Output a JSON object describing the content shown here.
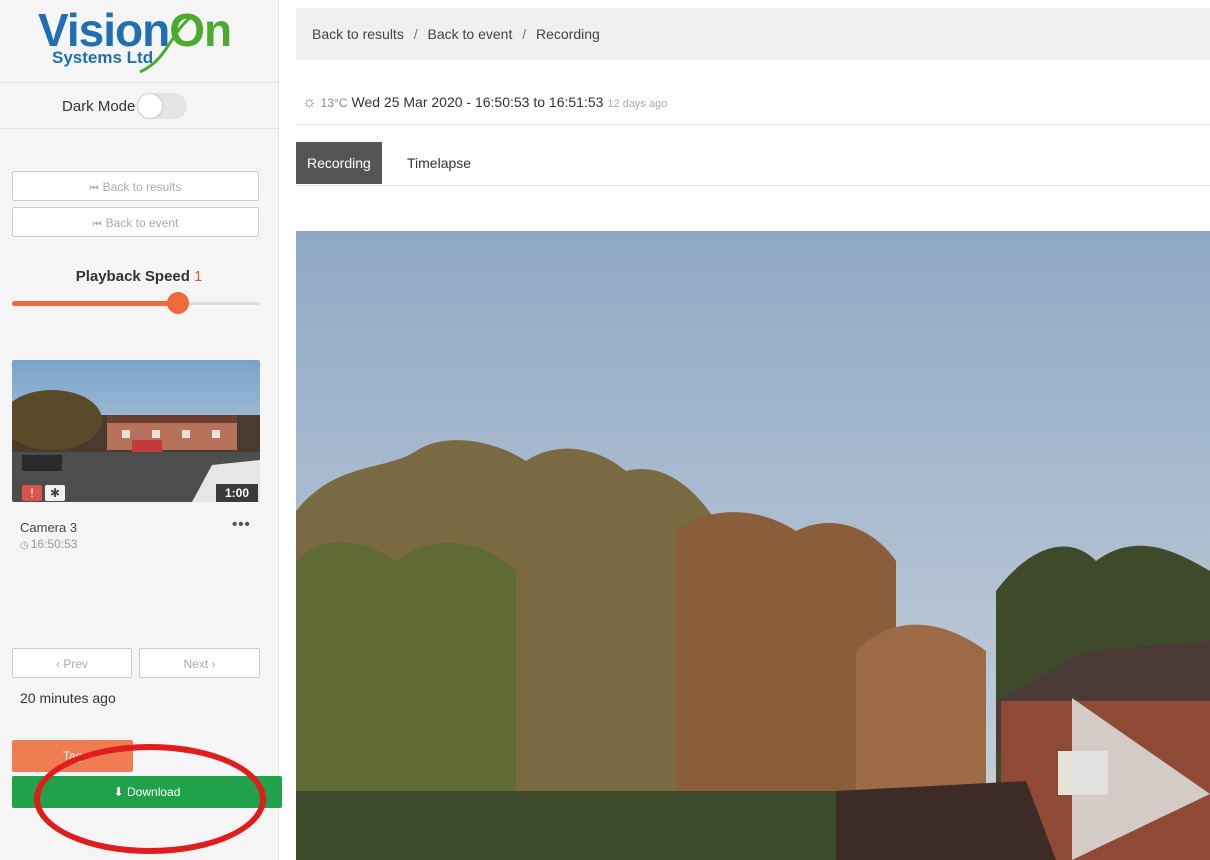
{
  "sidebar": {
    "logo": {
      "main": "Vision",
      "main_accent": "On",
      "sub": "Systems Ltd"
    },
    "dark_mode_label": "Dark Mode",
    "back_to_results": "Back to results",
    "back_to_event": "Back to event",
    "playback_speed_label": "Playback Speed",
    "playback_speed_value": "1",
    "playback_speed_fraction": 0.67,
    "clip": {
      "camera": "Camera 3",
      "time": "16:50:53",
      "duration": "1:00",
      "more": "•••"
    },
    "prev_label": "Prev",
    "next_label": "Next",
    "minutes_ago": "20 minutes ago",
    "tag_label": "Tag",
    "download_label": "Download"
  },
  "breadcrumb": {
    "items": [
      "Back to results",
      "Back to event",
      "Recording"
    ],
    "separator": "/"
  },
  "info": {
    "temperature": "13°C",
    "datetime": "Wed 25 Mar 2020 - 16:50:53 to 16:51:53",
    "ago": "12 days ago"
  },
  "tabs": [
    "Recording",
    "Timelapse"
  ],
  "colors": {
    "accent_orange": "#ef6a3a",
    "download_green": "#1fa24a",
    "logo_blue": "#1f6fb2",
    "logo_green": "#4cab2f",
    "annotation_red": "#e11c1c"
  },
  "icons": {
    "weather": "sun-icon",
    "player_play": "play-icon"
  }
}
